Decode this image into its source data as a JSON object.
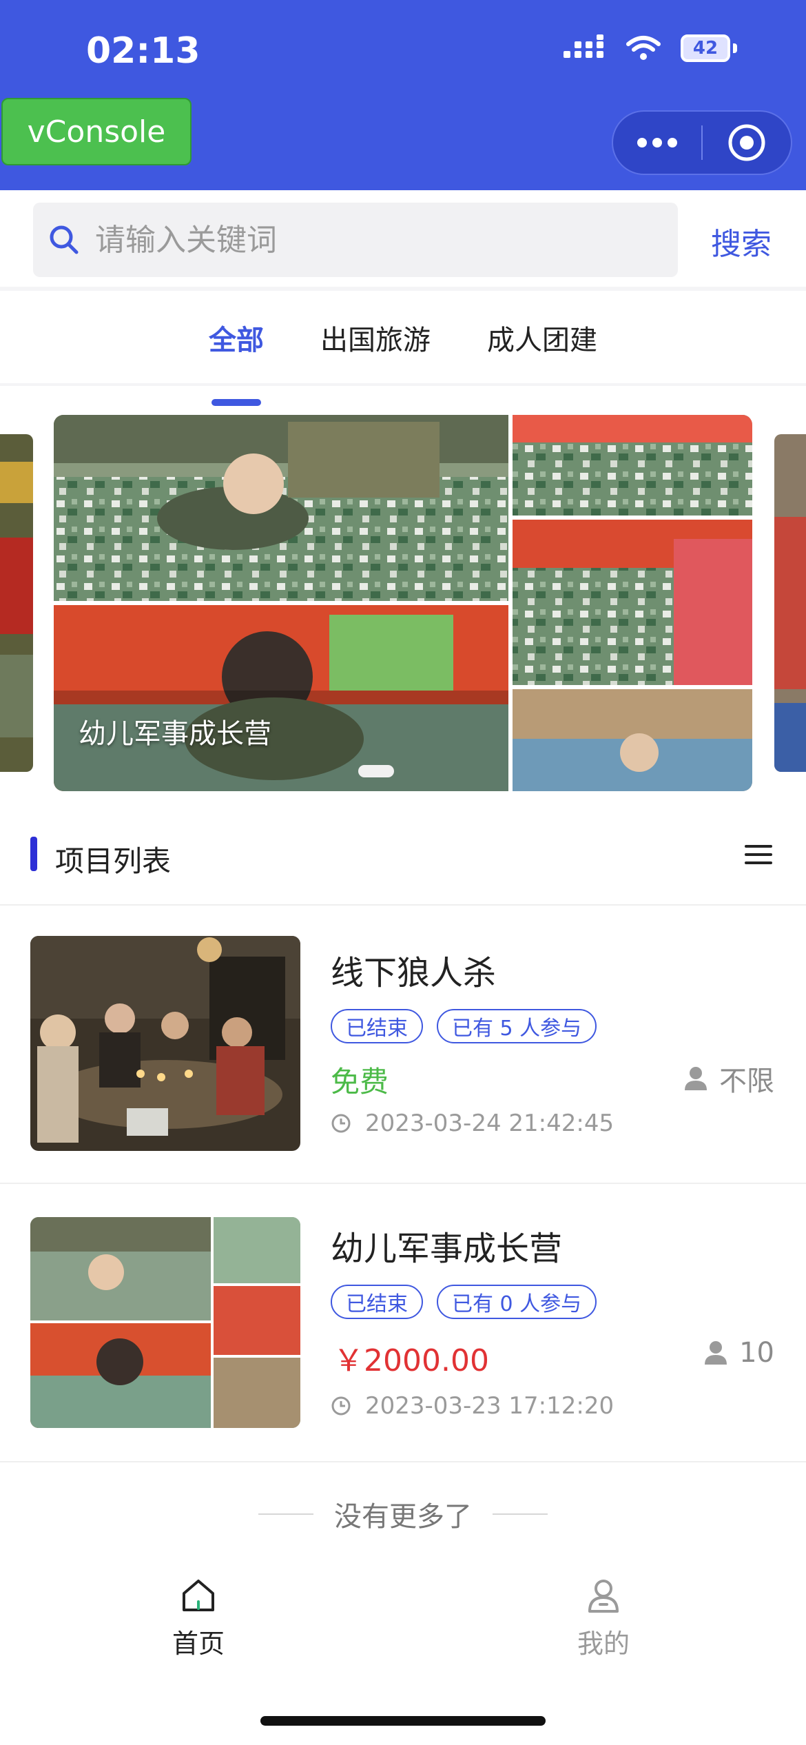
{
  "status_bar": {
    "time": "02:13",
    "battery": "42"
  },
  "vconsole": {
    "label": "vConsole"
  },
  "search": {
    "placeholder": "请输入关键词",
    "button_label": "搜索"
  },
  "tabs": [
    {
      "label": "全部",
      "active": true
    },
    {
      "label": "出国旅游",
      "active": false
    },
    {
      "label": "成人团建",
      "active": false
    }
  ],
  "banner": {
    "caption": "幼儿军事成长营"
  },
  "section": {
    "title": "项目列表"
  },
  "items": [
    {
      "title": "线下狼人杀",
      "status_tag": "已结束",
      "participants_tag": "已有 5 人参与",
      "price": "免费",
      "capacity": "不限",
      "datetime": "2023-03-24 21:42:45"
    },
    {
      "title": "幼儿军事成长营",
      "status_tag": "已结束",
      "participants_tag": "已有 0 人参与",
      "price": "￥2000.00",
      "capacity": "10",
      "datetime": "2023-03-23 17:12:20"
    }
  ],
  "footer": {
    "no_more": "没有更多了"
  },
  "nav": [
    {
      "label": "首页",
      "active": true
    },
    {
      "label": "我的",
      "active": false
    }
  ],
  "colors": {
    "primary": "#3f58e0",
    "free": "#4cba48",
    "price": "#e13234",
    "vconsole": "#4cc04f"
  }
}
